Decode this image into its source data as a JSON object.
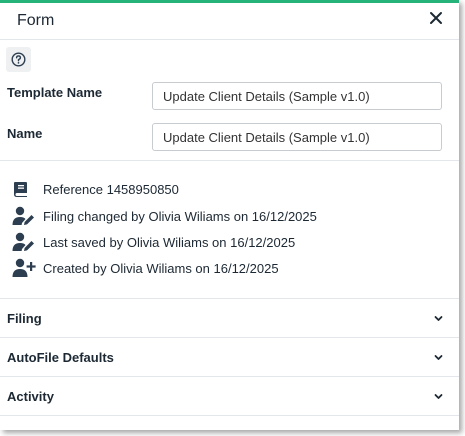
{
  "header": {
    "title": "Form"
  },
  "fields": {
    "template_name": {
      "label": "Template Name",
      "value": "Update Client Details (Sample v1.0)"
    },
    "name": {
      "label": "Name",
      "value": "Update Client Details (Sample v1.0)"
    }
  },
  "info": {
    "reference": "Reference 1458950850",
    "filing_changed": "Filing changed by Olivia Wiliams on 16/12/2025",
    "last_saved": "Last saved by Olivia Wiliams on 16/12/2025",
    "created": "Created by Olivia Wiliams on 16/12/2025"
  },
  "sections": [
    {
      "label": "Filing"
    },
    {
      "label": "AutoFile Defaults"
    },
    {
      "label": "Activity"
    }
  ],
  "colors": {
    "accent": "#26b37a",
    "icon": "#2c3e50"
  }
}
